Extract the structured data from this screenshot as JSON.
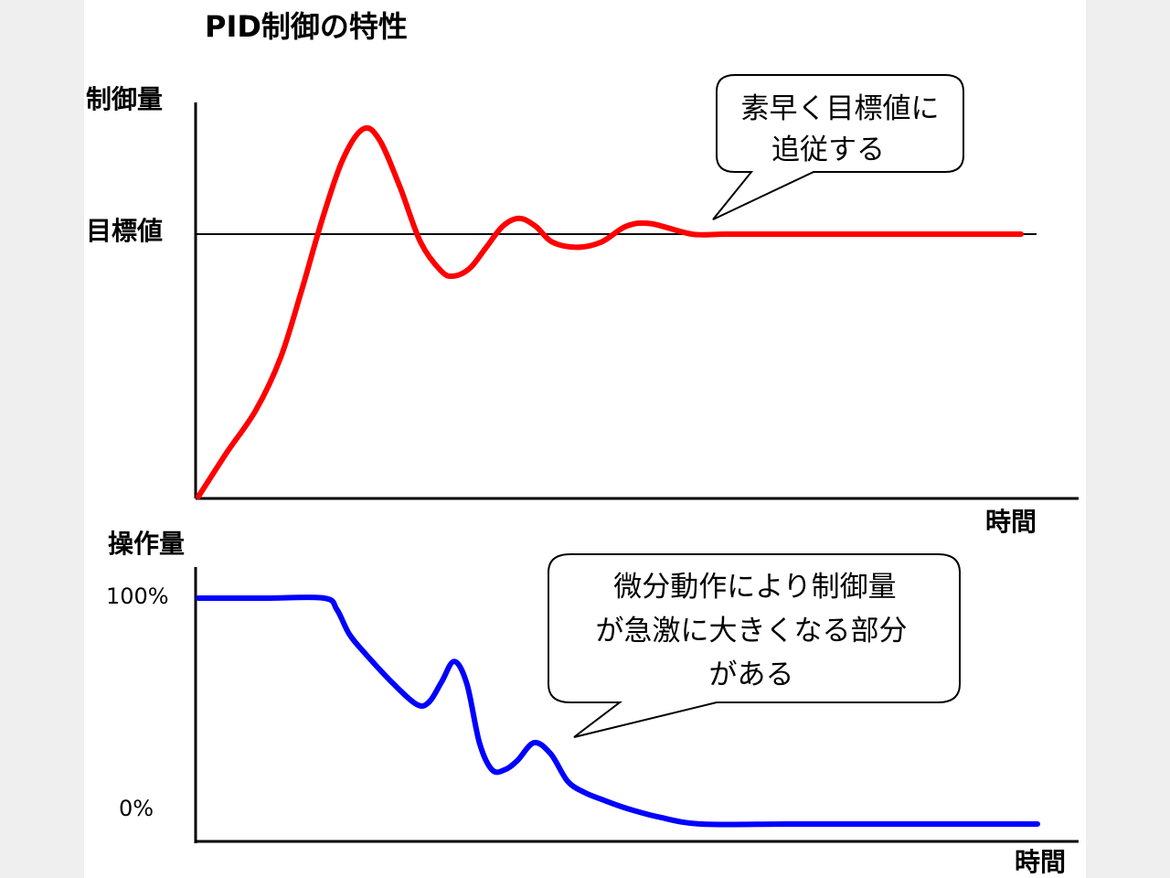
{
  "chart_data": {
    "title": "PID制御の特性",
    "charts": [
      {
        "type": "line",
        "ylabel": "制御量",
        "xlabel": "時間",
        "y_tick_labels": [
          "目標値"
        ],
        "target_value": 1.0,
        "xlim": [
          0,
          10
        ],
        "ylim": [
          0,
          1.5
        ],
        "grid": false,
        "series": [
          {
            "color": "#ff0000",
            "x": [
              0,
              0.35,
              0.7,
              1.0,
              1.25,
              1.5,
              1.75,
              2.0,
              2.2,
              2.45,
              2.7,
              2.95,
              3.1,
              3.3,
              3.5,
              3.7,
              3.9,
              4.1,
              4.3,
              4.6,
              4.9,
              5.2,
              5.5,
              6.0,
              6.4,
              6.8,
              7.3,
              7.8,
              8.5,
              9.2,
              10.0
            ],
            "y": [
              0,
              0.17,
              0.33,
              0.53,
              0.78,
              1.05,
              1.28,
              1.4,
              1.36,
              1.18,
              0.97,
              0.86,
              0.84,
              0.87,
              0.95,
              1.03,
              1.06,
              1.03,
              0.97,
              0.95,
              0.97,
              1.03,
              1.04,
              1.0,
              1.0,
              1.0,
              1.0,
              1.0,
              1.0,
              1.0,
              1.0
            ]
          }
        ],
        "annotation": [
          "素早く目標値に",
          "追従する"
        ]
      },
      {
        "type": "line",
        "ylabel": "操作量",
        "xlabel": "時間",
        "y_tick_labels": [
          "100%",
          "0%"
        ],
        "ylim": [
          0,
          100
        ],
        "xlim": [
          0,
          10
        ],
        "grid": false,
        "series": [
          {
            "color": "#0000ff",
            "x": [
              0,
              0.8,
              1.5,
              1.65,
              1.8,
              2.0,
              2.3,
              2.6,
              2.75,
              2.9,
              3.05,
              3.2,
              3.35,
              3.5,
              3.65,
              3.8,
              4.0,
              4.2,
              4.4,
              4.6,
              4.8,
              5.1,
              5.5,
              6.0,
              7.0,
              8.0,
              9.0,
              10.0
            ],
            "y": [
              100,
              100,
              100,
              95,
              84,
              75,
              63,
              53,
              54,
              63,
              72,
              62,
              36,
              24,
              24,
              28,
              36,
              31,
              19,
              14,
              11,
              7,
              3,
              0,
              0,
              0,
              0,
              0
            ]
          }
        ],
        "annotation": [
          "微分動作により制御量",
          "が急激に大きくなる部分",
          "がある"
        ]
      }
    ]
  }
}
